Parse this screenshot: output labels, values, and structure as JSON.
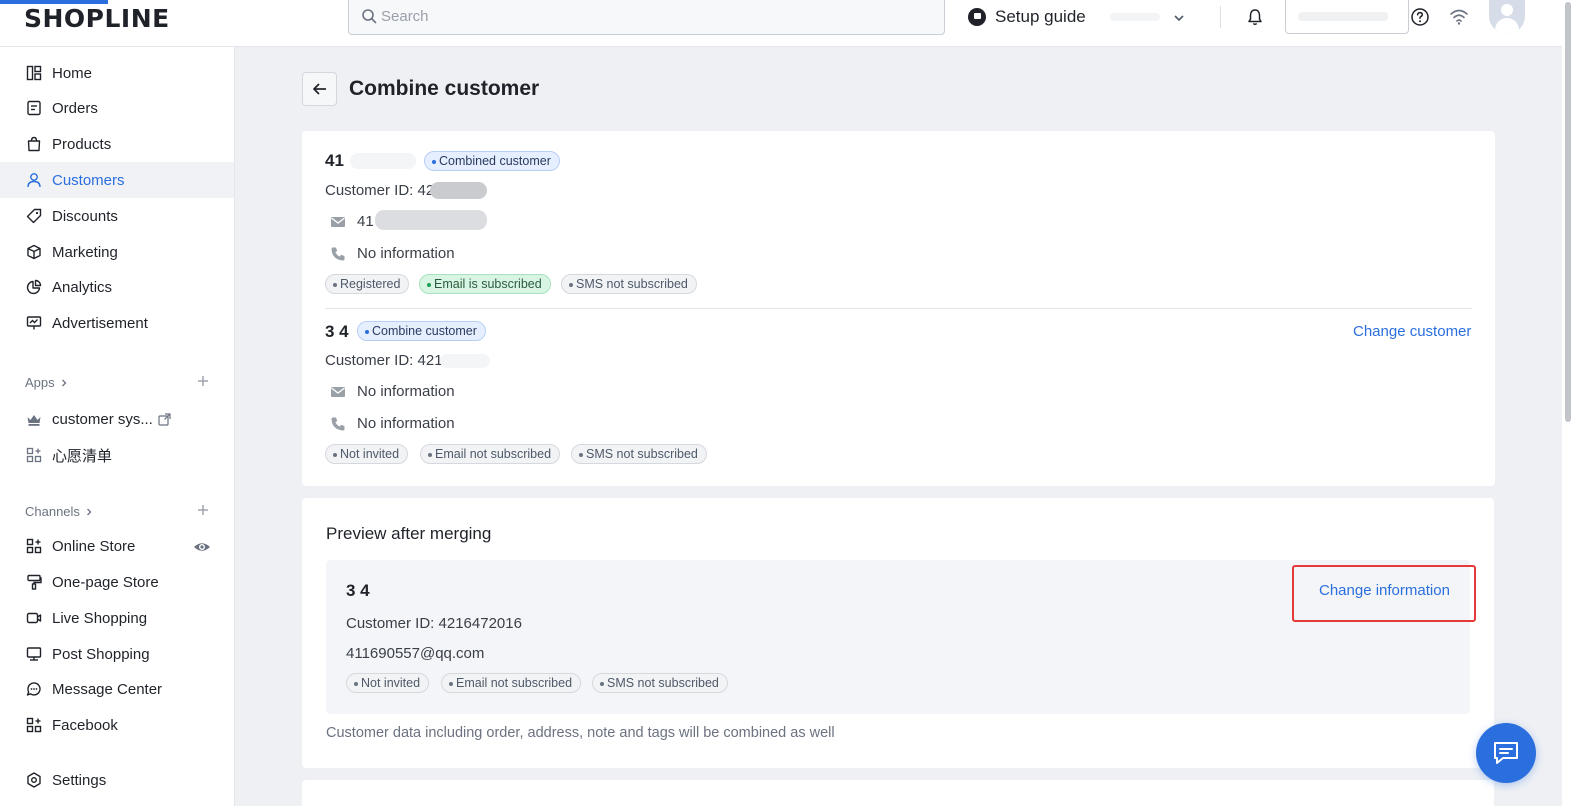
{
  "topbar": {
    "logo": "SHOPLINE",
    "search_placeholder": "Search",
    "setup_guide": "Setup guide"
  },
  "sidebar": {
    "items": [
      {
        "label": "Home",
        "icon": "home-icon"
      },
      {
        "label": "Orders",
        "icon": "orders-icon"
      },
      {
        "label": "Products",
        "icon": "products-icon"
      },
      {
        "label": "Customers",
        "icon": "customers-icon",
        "active": true
      },
      {
        "label": "Discounts",
        "icon": "discounts-icon"
      },
      {
        "label": "Marketing",
        "icon": "marketing-icon"
      },
      {
        "label": "Analytics",
        "icon": "analytics-icon"
      },
      {
        "label": "Advertisement",
        "icon": "advertisement-icon"
      }
    ],
    "apps_header": "Apps",
    "apps": [
      {
        "label": "customer sys...",
        "icon": "crown-icon"
      },
      {
        "label": "心愿清单",
        "icon": "apps-grid-icon"
      }
    ],
    "channels_header": "Channels",
    "channels": [
      {
        "label": "Online Store",
        "icon": "store-icon"
      },
      {
        "label": "One-page Store",
        "icon": "brush-icon"
      },
      {
        "label": "Live Shopping",
        "icon": "live-icon"
      },
      {
        "label": "Post Shopping",
        "icon": "post-icon"
      },
      {
        "label": "Message Center",
        "icon": "message-icon"
      },
      {
        "label": "Facebook",
        "icon": "facebook-grid-icon"
      }
    ],
    "settings": "Settings"
  },
  "page": {
    "title": "Combine customer"
  },
  "combined_customer": {
    "name": "41",
    "badge": "Combined customer",
    "customer_id": "Customer ID: 42",
    "email": "41",
    "phone": "No information",
    "tags": [
      "Registered",
      "Email is subscribed",
      "SMS not subscribed"
    ]
  },
  "combine_customer": {
    "name": "3 4",
    "badge": "Combine customer",
    "change_link": "Change customer",
    "customer_id": "Customer ID: 421",
    "email": "No information",
    "phone": "No information",
    "tags": [
      "Not invited",
      "Email not subscribed",
      "SMS not subscribed"
    ]
  },
  "preview": {
    "heading": "Preview after merging",
    "name": "3 4",
    "change_link": "Change information",
    "customer_id": "Customer ID: 4216472016",
    "email": "411690557@qq.com",
    "tags": [
      "Not invited",
      "Email not subscribed",
      "SMS not subscribed"
    ],
    "footnote": "Customer data including order, address, note and tags will be combined as well"
  },
  "colors": {
    "accent": "#2b6fde",
    "highlight_border": "#e63a3a"
  }
}
